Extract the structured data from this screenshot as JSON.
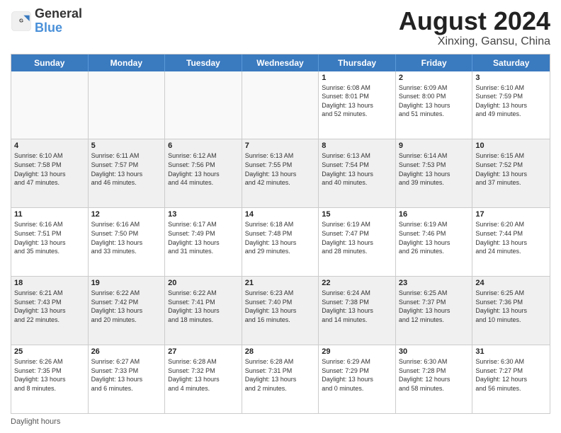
{
  "header": {
    "logo_general": "General",
    "logo_blue": "Blue",
    "month_year": "August 2024",
    "location": "Xinxing, Gansu, China"
  },
  "days_of_week": [
    "Sunday",
    "Monday",
    "Tuesday",
    "Wednesday",
    "Thursday",
    "Friday",
    "Saturday"
  ],
  "footer_label": "Daylight hours",
  "weeks": [
    [
      {
        "day": "",
        "text": ""
      },
      {
        "day": "",
        "text": ""
      },
      {
        "day": "",
        "text": ""
      },
      {
        "day": "",
        "text": ""
      },
      {
        "day": "1",
        "text": "Sunrise: 6:08 AM\nSunset: 8:01 PM\nDaylight: 13 hours\nand 52 minutes."
      },
      {
        "day": "2",
        "text": "Sunrise: 6:09 AM\nSunset: 8:00 PM\nDaylight: 13 hours\nand 51 minutes."
      },
      {
        "day": "3",
        "text": "Sunrise: 6:10 AM\nSunset: 7:59 PM\nDaylight: 13 hours\nand 49 minutes."
      }
    ],
    [
      {
        "day": "4",
        "text": "Sunrise: 6:10 AM\nSunset: 7:58 PM\nDaylight: 13 hours\nand 47 minutes."
      },
      {
        "day": "5",
        "text": "Sunrise: 6:11 AM\nSunset: 7:57 PM\nDaylight: 13 hours\nand 46 minutes."
      },
      {
        "day": "6",
        "text": "Sunrise: 6:12 AM\nSunset: 7:56 PM\nDaylight: 13 hours\nand 44 minutes."
      },
      {
        "day": "7",
        "text": "Sunrise: 6:13 AM\nSunset: 7:55 PM\nDaylight: 13 hours\nand 42 minutes."
      },
      {
        "day": "8",
        "text": "Sunrise: 6:13 AM\nSunset: 7:54 PM\nDaylight: 13 hours\nand 40 minutes."
      },
      {
        "day": "9",
        "text": "Sunrise: 6:14 AM\nSunset: 7:53 PM\nDaylight: 13 hours\nand 39 minutes."
      },
      {
        "day": "10",
        "text": "Sunrise: 6:15 AM\nSunset: 7:52 PM\nDaylight: 13 hours\nand 37 minutes."
      }
    ],
    [
      {
        "day": "11",
        "text": "Sunrise: 6:16 AM\nSunset: 7:51 PM\nDaylight: 13 hours\nand 35 minutes."
      },
      {
        "day": "12",
        "text": "Sunrise: 6:16 AM\nSunset: 7:50 PM\nDaylight: 13 hours\nand 33 minutes."
      },
      {
        "day": "13",
        "text": "Sunrise: 6:17 AM\nSunset: 7:49 PM\nDaylight: 13 hours\nand 31 minutes."
      },
      {
        "day": "14",
        "text": "Sunrise: 6:18 AM\nSunset: 7:48 PM\nDaylight: 13 hours\nand 29 minutes."
      },
      {
        "day": "15",
        "text": "Sunrise: 6:19 AM\nSunset: 7:47 PM\nDaylight: 13 hours\nand 28 minutes."
      },
      {
        "day": "16",
        "text": "Sunrise: 6:19 AM\nSunset: 7:46 PM\nDaylight: 13 hours\nand 26 minutes."
      },
      {
        "day": "17",
        "text": "Sunrise: 6:20 AM\nSunset: 7:44 PM\nDaylight: 13 hours\nand 24 minutes."
      }
    ],
    [
      {
        "day": "18",
        "text": "Sunrise: 6:21 AM\nSunset: 7:43 PM\nDaylight: 13 hours\nand 22 minutes."
      },
      {
        "day": "19",
        "text": "Sunrise: 6:22 AM\nSunset: 7:42 PM\nDaylight: 13 hours\nand 20 minutes."
      },
      {
        "day": "20",
        "text": "Sunrise: 6:22 AM\nSunset: 7:41 PM\nDaylight: 13 hours\nand 18 minutes."
      },
      {
        "day": "21",
        "text": "Sunrise: 6:23 AM\nSunset: 7:40 PM\nDaylight: 13 hours\nand 16 minutes."
      },
      {
        "day": "22",
        "text": "Sunrise: 6:24 AM\nSunset: 7:38 PM\nDaylight: 13 hours\nand 14 minutes."
      },
      {
        "day": "23",
        "text": "Sunrise: 6:25 AM\nSunset: 7:37 PM\nDaylight: 13 hours\nand 12 minutes."
      },
      {
        "day": "24",
        "text": "Sunrise: 6:25 AM\nSunset: 7:36 PM\nDaylight: 13 hours\nand 10 minutes."
      }
    ],
    [
      {
        "day": "25",
        "text": "Sunrise: 6:26 AM\nSunset: 7:35 PM\nDaylight: 13 hours\nand 8 minutes."
      },
      {
        "day": "26",
        "text": "Sunrise: 6:27 AM\nSunset: 7:33 PM\nDaylight: 13 hours\nand 6 minutes."
      },
      {
        "day": "27",
        "text": "Sunrise: 6:28 AM\nSunset: 7:32 PM\nDaylight: 13 hours\nand 4 minutes."
      },
      {
        "day": "28",
        "text": "Sunrise: 6:28 AM\nSunset: 7:31 PM\nDaylight: 13 hours\nand 2 minutes."
      },
      {
        "day": "29",
        "text": "Sunrise: 6:29 AM\nSunset: 7:29 PM\nDaylight: 13 hours\nand 0 minutes."
      },
      {
        "day": "30",
        "text": "Sunrise: 6:30 AM\nSunset: 7:28 PM\nDaylight: 12 hours\nand 58 minutes."
      },
      {
        "day": "31",
        "text": "Sunrise: 6:30 AM\nSunset: 7:27 PM\nDaylight: 12 hours\nand 56 minutes."
      }
    ]
  ]
}
